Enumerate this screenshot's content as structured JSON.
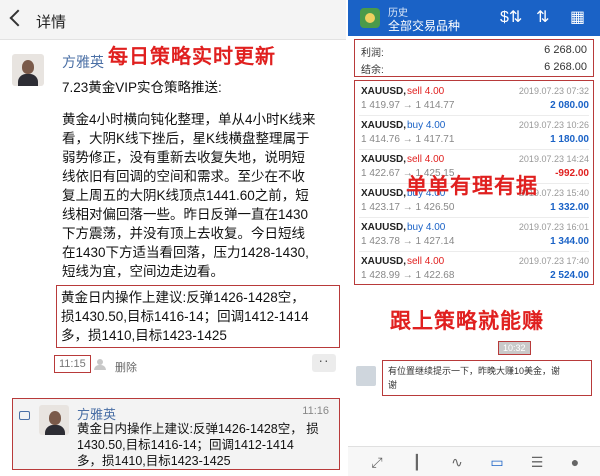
{
  "left": {
    "topbar": {
      "title": "详情",
      "back_icon": "chevron-left-icon"
    },
    "overlay_title": "每日策略实时更新",
    "post": {
      "author": "方雅英",
      "heading": "7.23黄金VIP实仓策略推送:",
      "body_lines": [
        "黄金4小时横向钝化整理，单从4小时K线来",
        "看，大阴K线下挫后，星K线横盘整理属于",
        "弱势修正，没有重新去收复失地，说明短",
        "线依旧有回调的空间和需求。至少在不收",
        "复上周五的大阴K线顶点1441.60之前，短",
        "线相对偏回落一些。昨日反弹一直在1430",
        "下方震荡，并没有顶上去收复。今日短线",
        "在1430下方适当看回落，压力1428-1430,",
        "短线为宜，空间边走边看。"
      ],
      "advice_lines": [
        "黄金日内操作上建议:反弹1426-1428空，",
        "损1430.50,目标1416-14；回调1412-1414",
        "多，损1410,目标1423-1425"
      ],
      "time": "11:15",
      "delete_label": "删除",
      "more_label": "··"
    },
    "reply": {
      "author": "方雅英",
      "time": "11:16",
      "lines": [
        "黄金日内操作上建议:反弹1426-1428空，  损",
        "1430.50,目标1416-14；回调1412-1414",
        "多，损1410,目标1423-1425"
      ]
    }
  },
  "right": {
    "header": {
      "label": "历史",
      "subtitle": "全部交易品种",
      "icons": [
        "currency-sort-icon",
        "sort-icon",
        "calendar-icon"
      ]
    },
    "summary": [
      {
        "label": "利润:",
        "value": "6 268.00"
      },
      {
        "label": "结余:",
        "value": "6 268.00"
      }
    ],
    "trades": [
      {
        "symbol": "XAUUSD,",
        "side": "sell 4.00",
        "dir": "sell",
        "prices": "1 419.97 → 1 414.77",
        "datetime": "2019.07.23 07:32",
        "pl": "2 080.00",
        "pl_sign": "pos"
      },
      {
        "symbol": "XAUUSD,",
        "side": "buy 4.00",
        "dir": "buy",
        "prices": "1 414.76 → 1 417.71",
        "datetime": "2019.07.23 10:26",
        "pl": "1 180.00",
        "pl_sign": "pos"
      },
      {
        "symbol": "XAUUSD,",
        "side": "sell 4.00",
        "dir": "sell",
        "prices": "1 422.67 → 1 425.15",
        "datetime": "2019.07.23 14:24",
        "pl": "-992.00",
        "pl_sign": "neg"
      },
      {
        "symbol": "XAUUSD,",
        "side": "buy 4.00",
        "dir": "buy",
        "prices": "1 423.17 → 1 426.50",
        "datetime": "2019.07.23 15:40",
        "pl": "1 332.00",
        "pl_sign": "pos"
      },
      {
        "symbol": "XAUUSD,",
        "side": "buy 4.00",
        "dir": "buy",
        "prices": "1 423.78 → 1 427.14",
        "datetime": "2019.07.23 16:01",
        "pl": "1 344.00",
        "pl_sign": "pos"
      },
      {
        "symbol": "XAUUSD,",
        "side": "sell 4.00",
        "dir": "sell",
        "prices": "1 428.99 → 1 422.68",
        "datetime": "2019.07.23 17:40",
        "pl": "2 524.00",
        "pl_sign": "pos"
      }
    ],
    "overlay_middle": "单单有理有据",
    "overlay_bottom": "跟上策略就能赚",
    "chat": {
      "time": "10:32",
      "message_lines": [
        "有位置继续提示一下，昨晚大赚10美金，谢",
        "谢"
      ]
    },
    "bottom_nav": [
      "chart-icon",
      "candlestick-icon",
      "trend-icon",
      "inbox-icon",
      "news-icon",
      "chat-icon"
    ]
  },
  "colors": {
    "accent_blue": "#1a62c6",
    "overlay_red": "#e0201f",
    "frame_red": "#b83a3a"
  }
}
